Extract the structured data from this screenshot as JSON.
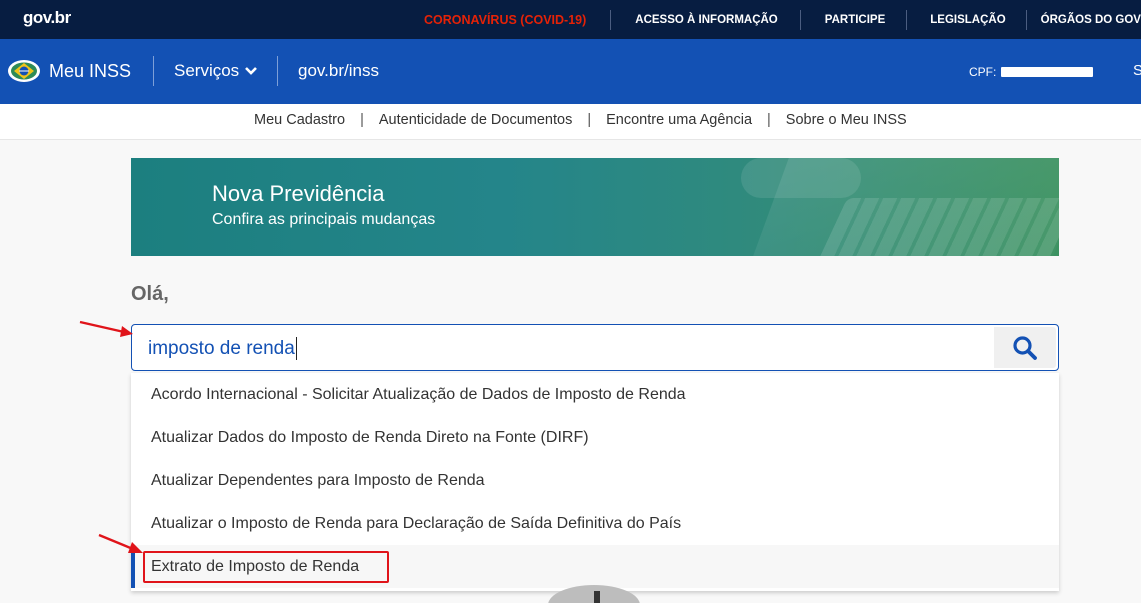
{
  "govbar": {
    "logo": "gov.br",
    "links": [
      "CORONAVÍRUS (COVID-19)",
      "ACESSO À INFORMAÇÃO",
      "PARTICIPE",
      "LEGISLAÇÃO",
      "ÓRGÃOS DO GOVERNO"
    ]
  },
  "header": {
    "title": "Meu INSS",
    "services": "Serviços",
    "govlink": "gov.br/inss",
    "cpf_label": "CPF:",
    "trailing": "S"
  },
  "subnav": {
    "items": [
      "Meu Cadastro",
      "Autenticidade de Documentos",
      "Encontre uma Agência",
      "Sobre o Meu INSS"
    ],
    "separator": "|"
  },
  "banner": {
    "title": "Nova Previdência",
    "subtitle": "Confira as principais mudanças"
  },
  "greeting": "Olá,",
  "search": {
    "value": "imposto de renda",
    "icon": "search-icon"
  },
  "suggestions": [
    "Acordo Internacional - Solicitar Atualização de Dados de Imposto de Renda",
    "Atualizar Dados do Imposto de Renda Direto na Fonte (DIRF)",
    "Atualizar Dependentes para Imposto de Renda",
    "Atualizar o Imposto de Renda para Declaração de Saída Definitiva do País",
    "Extrato de Imposto de Renda"
  ],
  "colors": {
    "govbar": "#071d41",
    "header": "#1351b4",
    "covid": "#e52207",
    "annotation": "#e0141a"
  }
}
